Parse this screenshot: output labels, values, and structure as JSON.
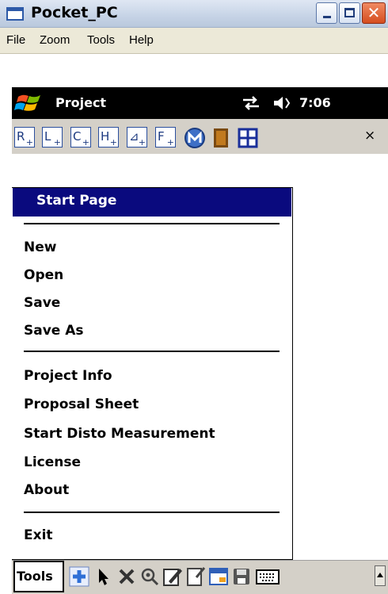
{
  "window": {
    "title": "Pocket_PC",
    "close_glyph": "✕"
  },
  "menubar": {
    "items": [
      "File",
      "Zoom",
      "Tools",
      "Help"
    ]
  },
  "device": {
    "app_title": "Project",
    "clock": "7:06",
    "icons": [
      "windows-start-icon",
      "connectivity-icon",
      "speaker-icon"
    ]
  },
  "toolstrip": {
    "buttons": [
      {
        "letter": "R",
        "sub": "+"
      },
      {
        "letter": "L",
        "sub": "+"
      },
      {
        "letter": "C",
        "sub": "+"
      },
      {
        "letter": "H",
        "sub": "+"
      },
      {
        "letter": "⊿",
        "sub": "+"
      },
      {
        "letter": "F",
        "sub": "+"
      }
    ],
    "close": "×"
  },
  "popup": {
    "selected": "Start Page",
    "group1": [
      "New",
      "Open",
      "Save",
      "Save As"
    ],
    "group2": [
      "Project Info",
      "Proposal Sheet",
      "Start Disto Measurement",
      "License",
      "About"
    ],
    "group3": [
      "Exit"
    ]
  },
  "cmdbar": {
    "tools_label": "Tools",
    "icons": [
      "add-icon",
      "pointer-icon",
      "delete-icon",
      "settings-icon",
      "edit-icon",
      "note-icon",
      "window-icon",
      "save-icon",
      "keyboard-icon",
      "up-arrow-icon"
    ]
  },
  "colors": {
    "selection": "#0a0a7e",
    "menubar": "#ece9d8",
    "toolbar": "#d4d0c8"
  }
}
